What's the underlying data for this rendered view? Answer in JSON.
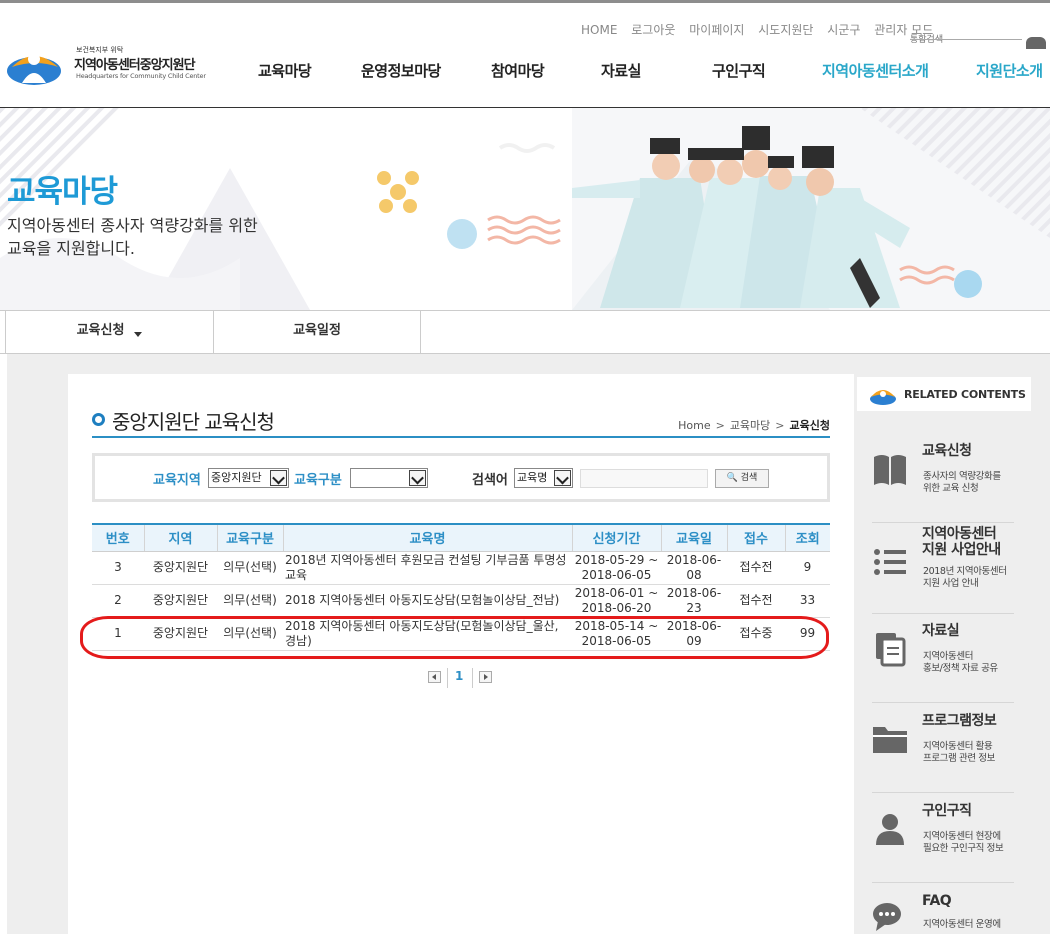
{
  "header": {
    "logo_small": "보건복지부 위탁",
    "logo_name": "지역아동센터중앙지원단",
    "logo_eng": "Headquarters for Community Child Center",
    "util_links": [
      "HOME",
      "로그아웃",
      "마이페이지",
      "시도지원단",
      "시군구",
      "관리자 모드"
    ],
    "search_label": "통합검색",
    "gnb": [
      "교육마당",
      "운영정보마당",
      "참여마당",
      "자료실",
      "구인구직",
      "지역아동센터소개",
      "지원단소개"
    ]
  },
  "banner": {
    "title": "교육마당",
    "desc_line1": "지역아동센터 종사자 역량강화를 위한",
    "desc_line2": "교육을 지원합니다."
  },
  "subtabs": [
    "교육신청",
    "교육일정"
  ],
  "page": {
    "title": "중앙지원단 교육신청",
    "breadcrumb": [
      "Home",
      "교육마당",
      "교육신청"
    ]
  },
  "search": {
    "region_label": "교육지역",
    "region_value": "중앙지원단",
    "type_label": "교육구분",
    "type_value": "",
    "keyword_label": "검색어",
    "keyword_field": "교육명",
    "keyword_value": "",
    "button": "검색"
  },
  "table": {
    "headers": [
      "번호",
      "지역",
      "교육구분",
      "교육명",
      "신청기간",
      "교육일",
      "접수",
      "조회"
    ],
    "rows": [
      {
        "no": "3",
        "region": "중앙지원단",
        "type": "의무(선택)",
        "title": "2018년 지역아동센터 후원모금 컨설팅 기부금품 투명성 교육",
        "period_start": "2018-05-29 ~",
        "period_end": "2018-06-05",
        "date": "2018-06-08",
        "status": "접수전",
        "views": "9"
      },
      {
        "no": "2",
        "region": "중앙지원단",
        "type": "의무(선택)",
        "title": "2018 지역아동센터 아동지도상담(모험놀이상담_전남)",
        "period_start": "2018-06-01 ~",
        "period_end": "2018-06-20",
        "date": "2018-06-23",
        "status": "접수전",
        "views": "33"
      },
      {
        "no": "1",
        "region": "중앙지원단",
        "type": "의무(선택)",
        "title": "2018 지역아동센터 아동지도상담(모험놀이상담_울산, 경남)",
        "period_start": "2018-05-14 ~",
        "period_end": "2018-06-05",
        "date": "2018-06-09",
        "status": "접수중",
        "views": "99"
      }
    ]
  },
  "pager": {
    "current": "1"
  },
  "sidebar": {
    "heading": "RELATED CONTENTS",
    "items": [
      {
        "title": "교육신청",
        "desc1": "종사자의 역량강화를",
        "desc2": "위한 교육 신청",
        "icon": "book-icon"
      },
      {
        "title": "지역아동센터",
        "title2": "지원 사업안내",
        "desc1": "2018년 지역아동센터",
        "desc2": "지원 사업 안내",
        "icon": "list-icon"
      },
      {
        "title": "자료실",
        "desc1": "지역아동센터",
        "desc2": "홍보/정책 자료 공유",
        "icon": "document-icon"
      },
      {
        "title": "프로그램정보",
        "desc1": "지역아동센터 활용",
        "desc2": "프로그램 관련 정보",
        "icon": "folder-icon"
      },
      {
        "title": "구인구직",
        "desc1": "지역아동센터 현장에",
        "desc2": "필요한 구인구직 정보",
        "icon": "person-icon"
      },
      {
        "title": "FAQ",
        "desc1": "지역아동센터 운영에",
        "desc2": "",
        "icon": "chat-icon"
      }
    ]
  },
  "colors": {
    "accent": "#2d8fc6",
    "highlight": "#e41b1b",
    "nav_active": "#2aa7c9"
  }
}
